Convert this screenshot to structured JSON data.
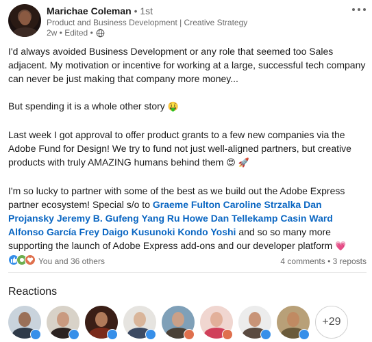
{
  "post": {
    "author": {
      "name": "Marichae Coleman",
      "degree": "• 1st",
      "headline": "Product and Business Development | Creative Strategy",
      "meta": "2w • Edited •"
    },
    "more_icon": "more-horizontal-icon",
    "body": {
      "p1": "I'd always avoided Business Development or any role that seemed too Sales adjacent. My motivation or incentive for working at a large, successful tech company can never be just making that company more money...",
      "p2": "But spending it is a whole other story",
      "p3": "Last week I got approval to offer product grants to a few new companies via the Adobe Fund for Design! We try to fund not just well-aligned partners, but creative products with truly AMAZING humans behind them",
      "p4_start": "I'm so lucky to partner with some of the best as we build out the Adobe Express partner ecosystem! Special s/o to",
      "mentions": [
        "Graeme Fulton",
        "Caroline Strzalka",
        "Dan Projansky",
        "Jeremy B. Gufeng",
        "Yang Ru",
        "Howe",
        "Dan Tellekamp",
        "Casin Ward",
        "Alfonso García Frey",
        "Daigo Kusunoki",
        "Kondo Yoshi"
      ],
      "p4_end": "and so so many more supporting the launch of Adobe Express add-ons and our developer platform",
      "emojis": {
        "money": "🤑",
        "heart_eyes": "😍",
        "rocket": "🚀",
        "heart": "💗"
      }
    },
    "social": {
      "reactors": "You and 36 others",
      "comments": "4 comments",
      "separator": "•",
      "reposts": "3 reposts",
      "reaction_types": [
        "like",
        "support",
        "love"
      ]
    },
    "reactions_section": {
      "title": "Reactions",
      "more_count": "+29",
      "reactors": [
        {
          "reaction": "like"
        },
        {
          "reaction": "like"
        },
        {
          "reaction": "like"
        },
        {
          "reaction": "like"
        },
        {
          "reaction": "love"
        },
        {
          "reaction": "love"
        },
        {
          "reaction": "like"
        },
        {
          "reaction": "like"
        }
      ]
    }
  },
  "colors": {
    "link": "#0a66c2",
    "like": "#378fe9",
    "support": "#6dae4f",
    "love": "#df704d"
  }
}
